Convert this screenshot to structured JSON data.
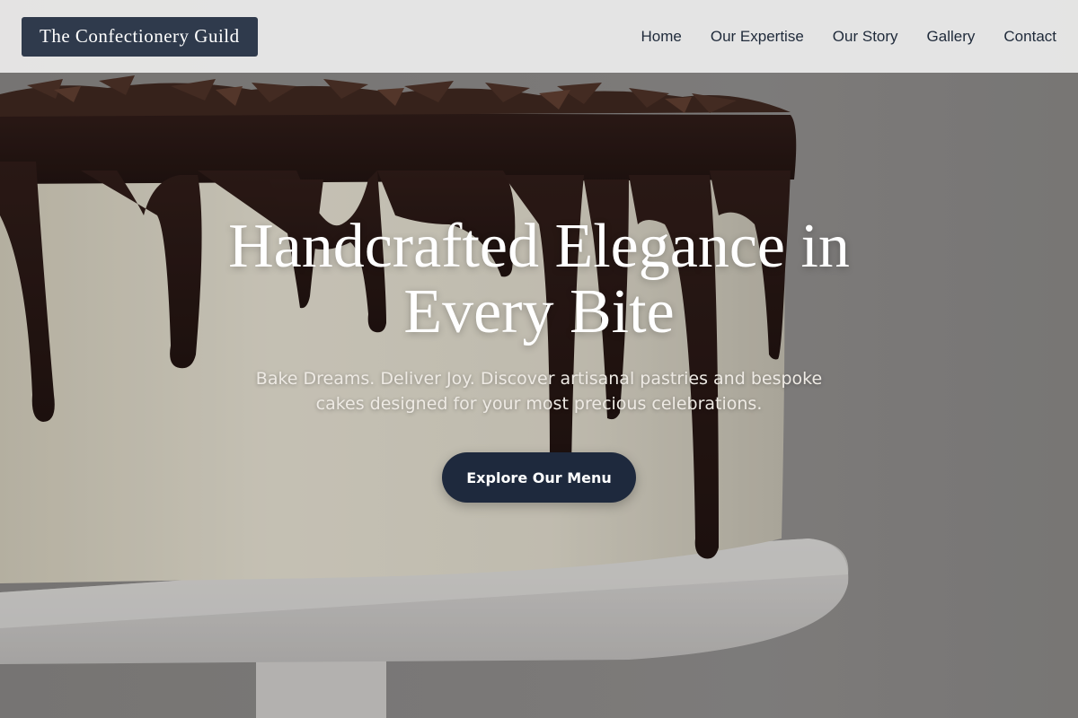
{
  "header": {
    "brand": "The Confectionery Guild",
    "nav": [
      {
        "label": "Home"
      },
      {
        "label": "Our Expertise"
      },
      {
        "label": "Our Story"
      },
      {
        "label": "Gallery"
      },
      {
        "label": "Contact"
      }
    ]
  },
  "hero": {
    "title": "Handcrafted Elegance in Every Bite",
    "subtitle": "Bake Dreams. Deliver Joy. Discover artisanal pastries and bespoke cakes designed for your most precious celebrations.",
    "cta_label": "Explore Our Menu",
    "background_image": "chocolate-drip-cake"
  },
  "colors": {
    "brand_bg": "#2f3a4c",
    "cta_bg": "#1e293d",
    "header_bg": "#e8e8e8",
    "nav_text": "#1f2a3a"
  }
}
